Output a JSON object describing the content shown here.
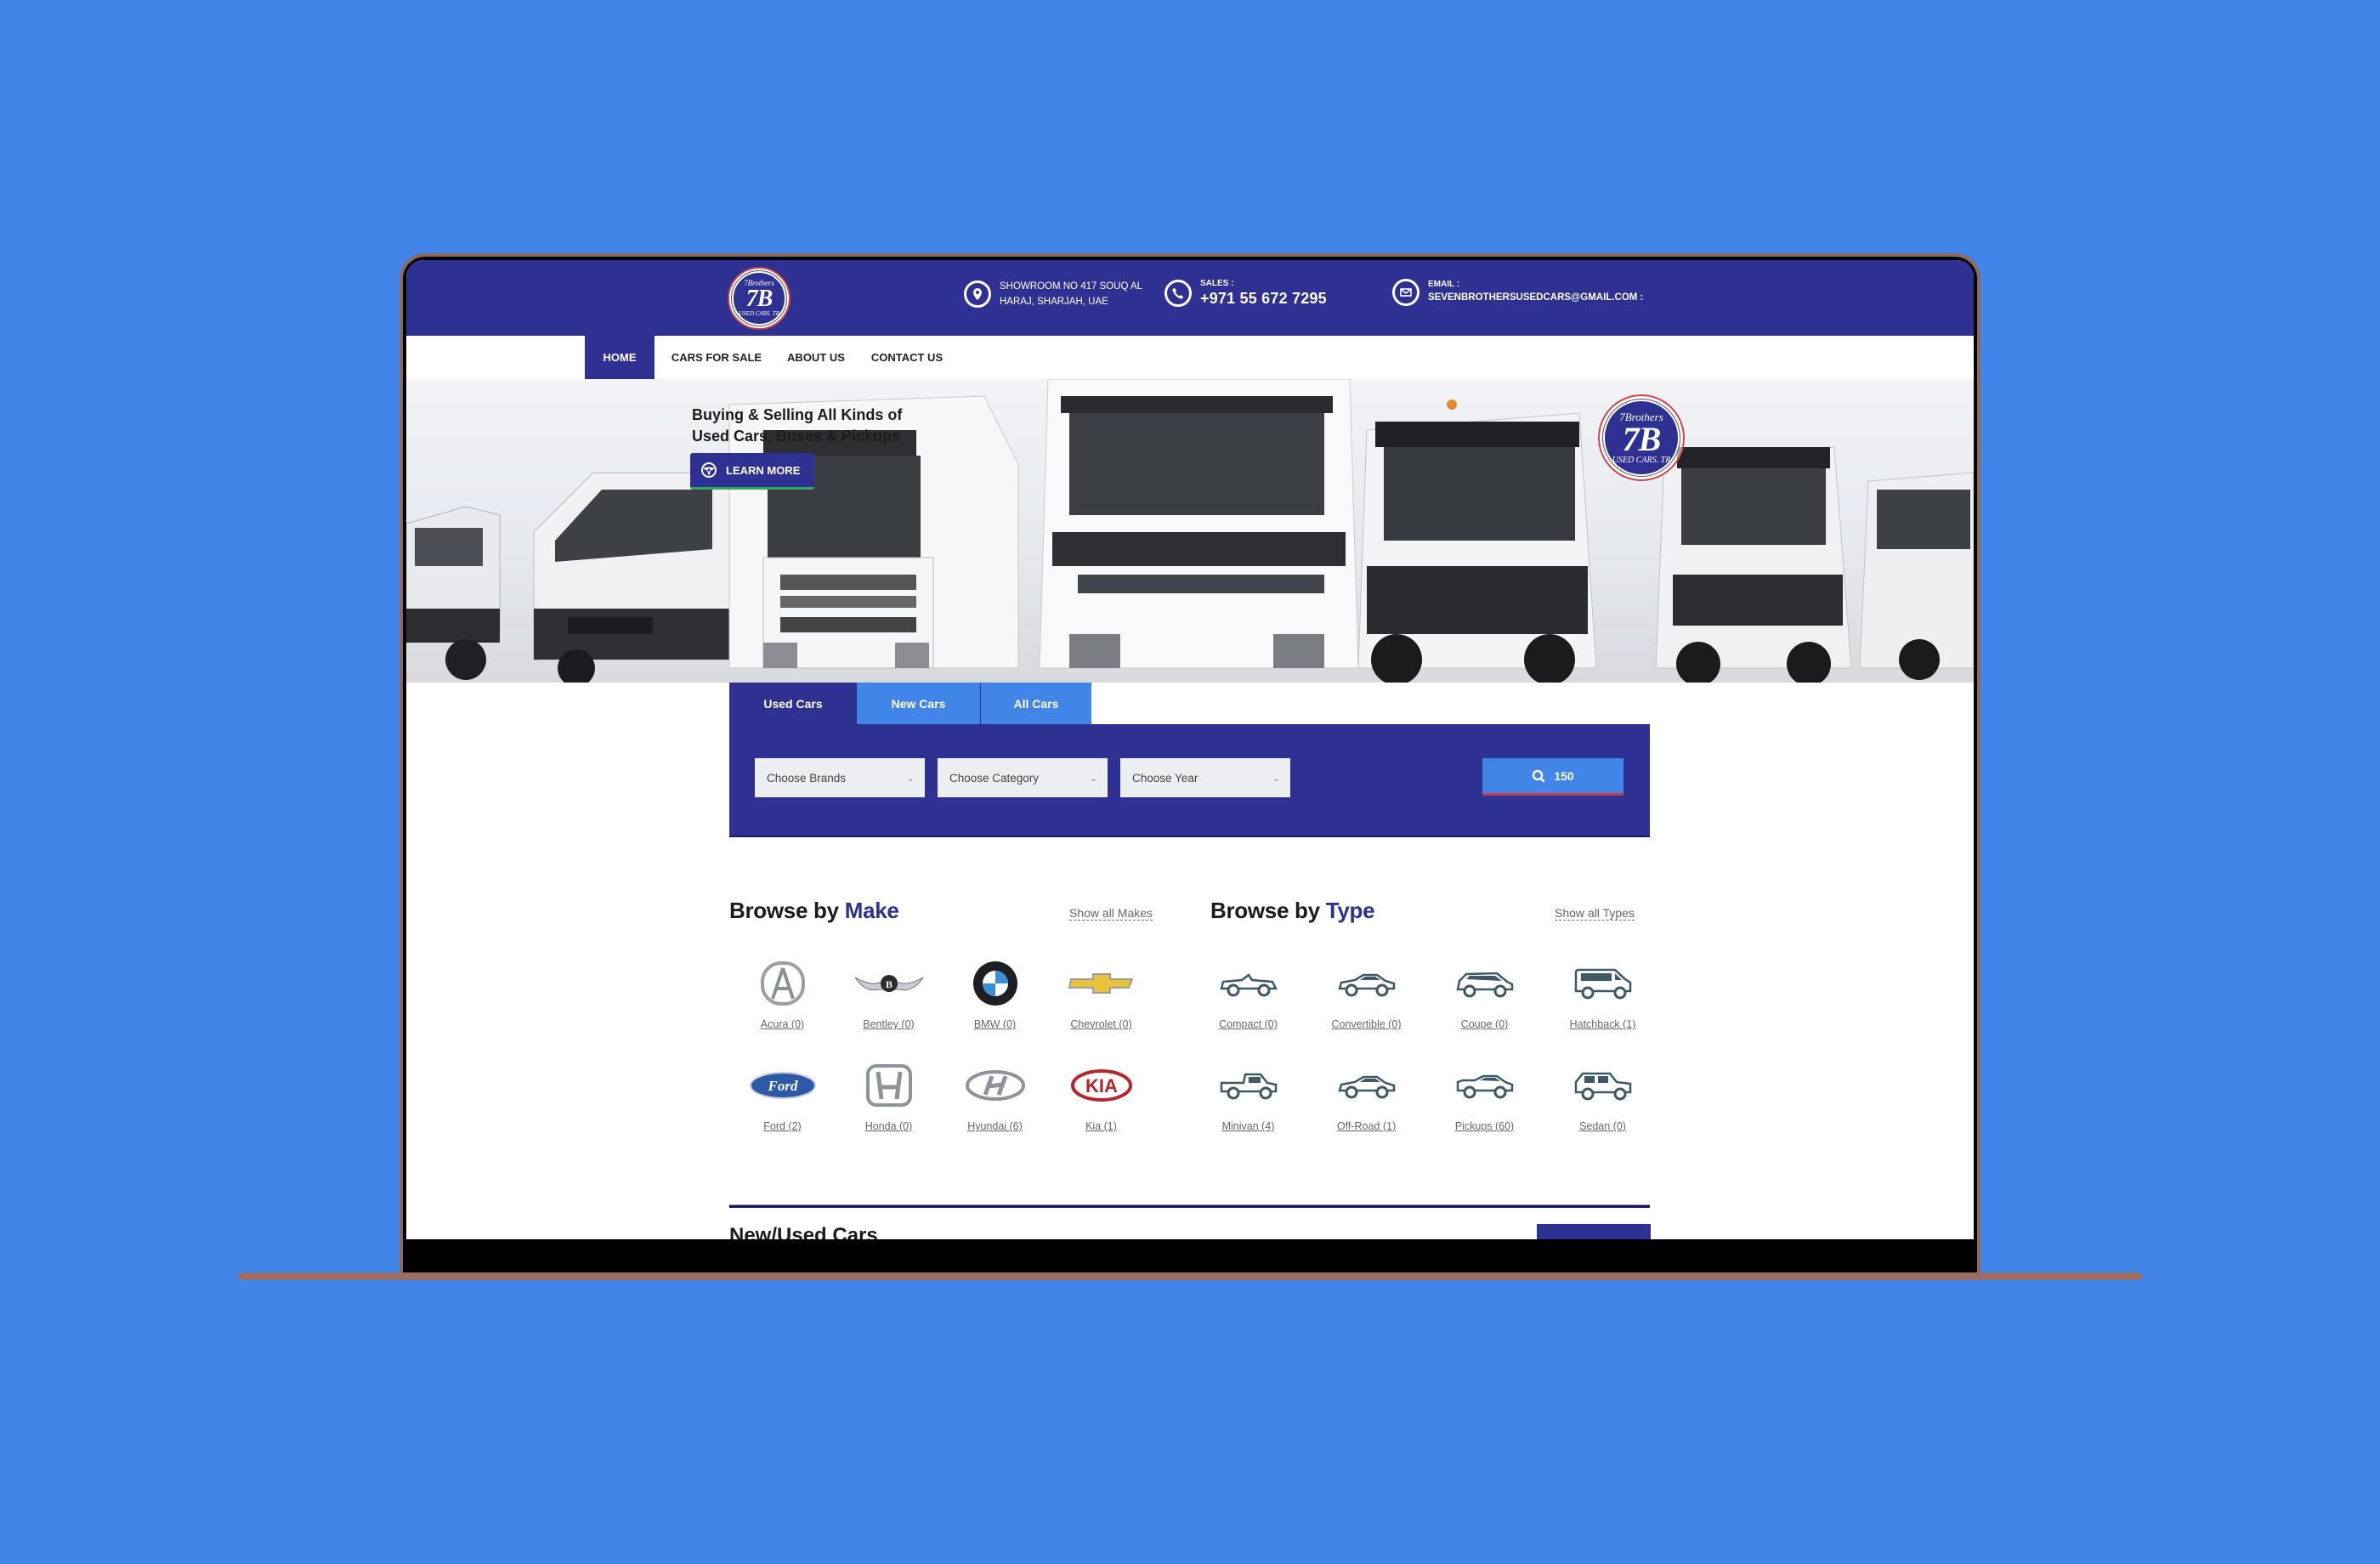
{
  "header": {
    "logo": {
      "top": "7Brothers",
      "main": "7B",
      "bottom": "USED CARS. TR"
    },
    "address": {
      "icon": "map-pin-icon",
      "line1": "SHOWROOM NO 417 SOUQ AL",
      "line2": "HARAJ, SHARJAH, UAE"
    },
    "sales": {
      "icon": "phone-icon",
      "label": "SALES :",
      "value": "+971 55 672 7295"
    },
    "email": {
      "icon": "envelope-icon",
      "label": "EMAIL :",
      "value": "SEVENBROTHERSUSEDCARS@GMAIL.COM :"
    }
  },
  "nav": {
    "items": [
      {
        "label": "HOME",
        "active": true
      },
      {
        "label": "CARS FOR SALE",
        "active": false
      },
      {
        "label": "ABOUT US",
        "active": false
      },
      {
        "label": "CONTACT US",
        "active": false
      }
    ]
  },
  "hero": {
    "title_line1": "Buying & Selling All Kinds of",
    "title_line2": "Used Cars, Buses & Pickups",
    "button_label": "LEARN MORE",
    "button_icon": "steering-wheel-icon"
  },
  "search": {
    "tabs": [
      {
        "label": "Used Cars",
        "active": true
      },
      {
        "label": "New Cars",
        "active": false
      },
      {
        "label": "All Cars",
        "active": false
      }
    ],
    "selects": [
      {
        "placeholder": "Choose Brands"
      },
      {
        "placeholder": "Choose Category"
      },
      {
        "placeholder": "Choose Year"
      }
    ],
    "button_count": "150",
    "button_icon": "search-icon"
  },
  "browse_make": {
    "title_prefix": "Browse by",
    "title_accent": "Make",
    "show_all": "Show all Makes",
    "items": [
      {
        "label": "Acura (0)",
        "icon": "acura-logo-icon"
      },
      {
        "label": "Bentley (0)",
        "icon": "bentley-logo-icon"
      },
      {
        "label": "BMW (0)",
        "icon": "bmw-logo-icon"
      },
      {
        "label": "Chevrolet (0)",
        "icon": "chevrolet-logo-icon"
      },
      {
        "label": "Ford (2)",
        "icon": "ford-logo-icon"
      },
      {
        "label": "Honda (0)",
        "icon": "honda-logo-icon"
      },
      {
        "label": "Hyundai (6)",
        "icon": "hyundai-logo-icon"
      },
      {
        "label": "Kia (1)",
        "icon": "kia-logo-icon"
      }
    ]
  },
  "browse_type": {
    "title_prefix": "Browse by",
    "title_accent": "Type",
    "show_all": "Show all Types",
    "items": [
      {
        "label": "Compact (0)",
        "icon": "convertible-car-icon"
      },
      {
        "label": "Convertible (0)",
        "icon": "sedan-car-icon"
      },
      {
        "label": "Coupe (0)",
        "icon": "hatchback-car-icon"
      },
      {
        "label": "Hatchback (1)",
        "icon": "van-icon"
      },
      {
        "label": "Minivan (4)",
        "icon": "pickup-truck-icon"
      },
      {
        "label": "Off-Road (1)",
        "icon": "sedan-car-icon"
      },
      {
        "label": "Pickups (60)",
        "icon": "sports-car-icon"
      },
      {
        "label": "Sedan (0)",
        "icon": "suv-icon"
      }
    ]
  },
  "section2": {
    "title": "New/Used Cars"
  },
  "colors": {
    "brand": "#2e3192",
    "accent": "#4285e8",
    "background": "#4285e8"
  }
}
